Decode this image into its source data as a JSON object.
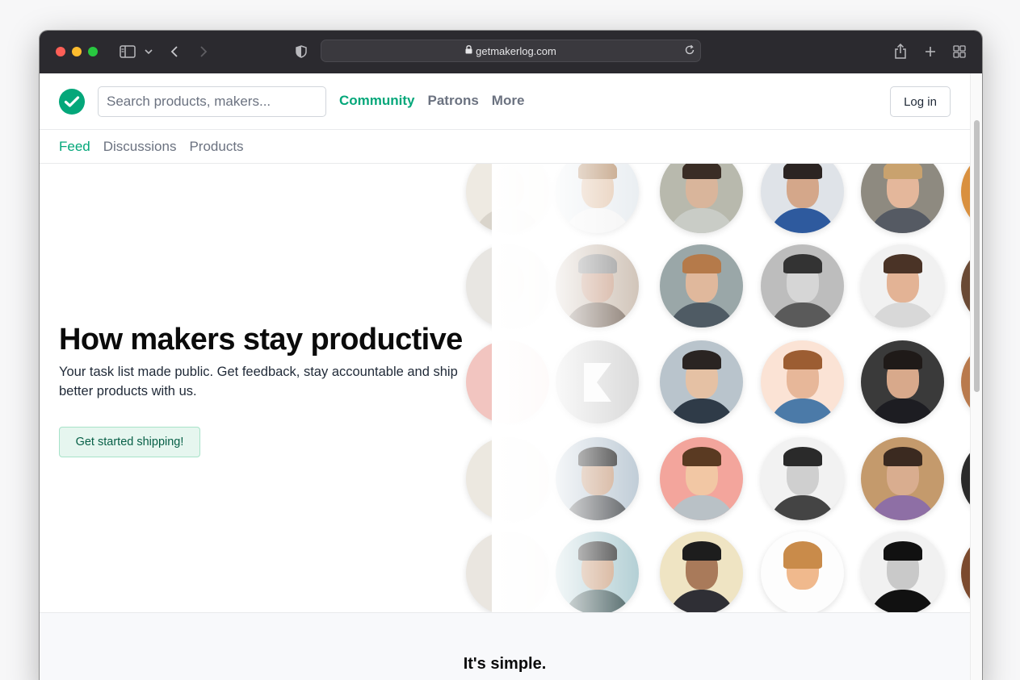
{
  "browser": {
    "url": "getmakerlog.com"
  },
  "header": {
    "search_placeholder": "Search products, makers...",
    "nav": [
      "Community",
      "Patrons",
      "More"
    ],
    "login_label": "Log in"
  },
  "subnav": [
    "Feed",
    "Discussions",
    "Products"
  ],
  "hero": {
    "title": "How makers stay productive",
    "subtitle": "Your task list made public. Get feedback, stay accountable and ship better products with us.",
    "cta_label": "Get started shipping!"
  },
  "section": {
    "title": "It's simple."
  },
  "colors": {
    "brand": "#04a77a",
    "titlebar": "#2b2a2f"
  },
  "icons": [
    "sidebar-icon",
    "chevron-down-icon",
    "back-icon",
    "forward-icon",
    "shield-icon",
    "lock-icon",
    "reload-icon",
    "share-icon",
    "plus-icon",
    "tabs-grid-icon",
    "checkmark-logo-icon"
  ]
}
